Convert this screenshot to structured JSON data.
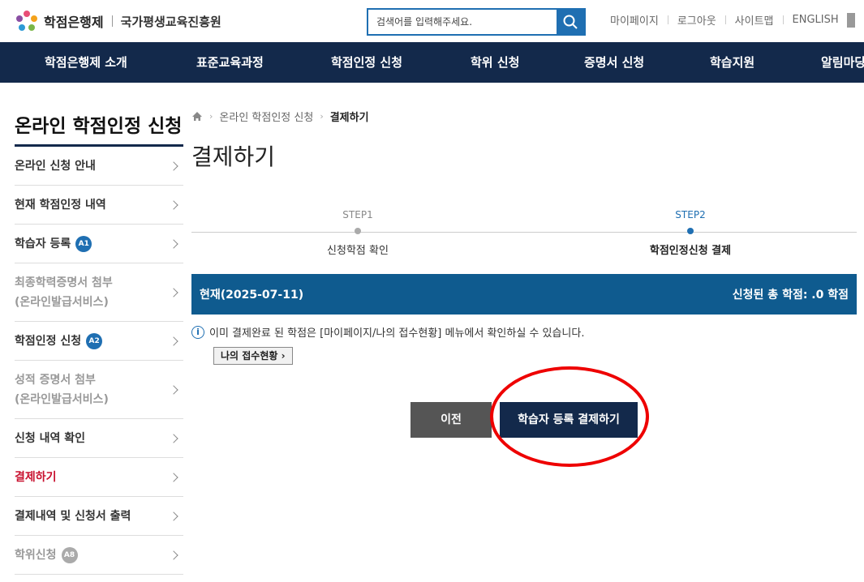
{
  "header": {
    "logo_name": "학점은행제",
    "logo_org": "국가평생교육진흥원",
    "search_placeholder": "검색어를 입력해주세요.",
    "util_links": [
      "마이페이지",
      "로그아웃",
      "사이트맵",
      "ENGLISH"
    ]
  },
  "gnb": [
    "학점은행제 소개",
    "표준교육과정",
    "학점인정 신청",
    "학위 신청",
    "증명서 신청",
    "학습지원",
    "알림마당"
  ],
  "sidebar": {
    "title": "온라인 학점인정 신청",
    "items": [
      {
        "label": "온라인 신청 안내"
      },
      {
        "label": "현재 학점인정 내역"
      },
      {
        "label": "학습자 등록",
        "badge": "A1"
      },
      {
        "label": "최종학력증명서 첨부",
        "sub": "(온라인발급서비스)"
      },
      {
        "label": "학점인정 신청",
        "badge": "A2"
      },
      {
        "label": "성적 증명서 첨부",
        "sub": "(온라인발급서비스)"
      },
      {
        "label": "신청 내역 확인"
      },
      {
        "label": "결제하기"
      },
      {
        "label": "결제내역 및 신청서 출력"
      },
      {
        "label": "학위신청",
        "badge": "A8"
      }
    ]
  },
  "breadcrumb": {
    "section": "온라인 학점인정 신청",
    "current": "결제하기"
  },
  "page_title": "결제하기",
  "steps": [
    {
      "num": "STEP1",
      "name": "신청학점 확인"
    },
    {
      "num": "STEP2",
      "name": "학점인정신청 결제"
    }
  ],
  "status_bar": {
    "left": "현재(2025-07-11)",
    "right": "신청된 총 학점: .0 학점"
  },
  "notice": "이미 결제완료 된 학점은 [마이페이지/나의 접수현황] 메뉴에서 확인하실 수 있습니다.",
  "my_status_button": "나의 접수현황",
  "buttons": {
    "prev": "이전",
    "pay": "학습자 등록 결제하기"
  },
  "colors": {
    "navy": "#13294b",
    "blue": "#0f5b8f",
    "highlight": "#e00000",
    "active": "#c8102e"
  }
}
